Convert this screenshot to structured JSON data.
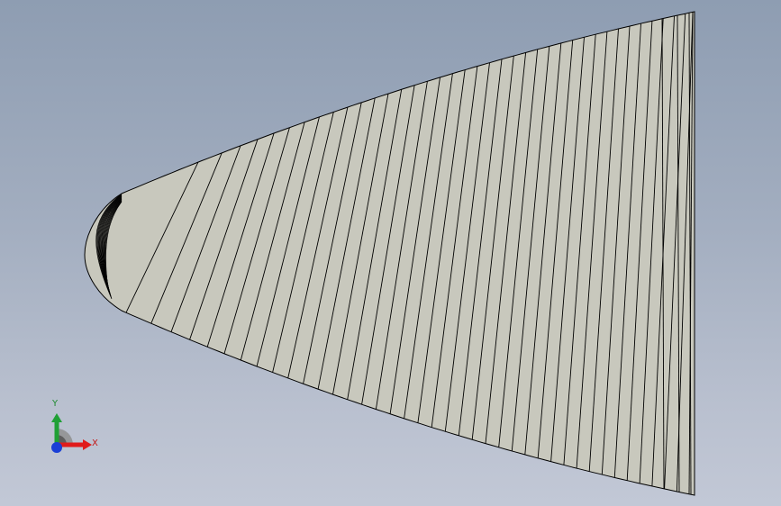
{
  "viewport": {
    "background_top": "#8e9db2",
    "background_bottom": "#c2c8d6"
  },
  "model": {
    "surface_color": "#c8c8bd",
    "edge_color": "#000000"
  },
  "triad": {
    "x_label": "X",
    "y_label": "Y",
    "x_color": "#e01b1b",
    "y_color": "#1fa035",
    "z_color": "#1a3fd6"
  }
}
